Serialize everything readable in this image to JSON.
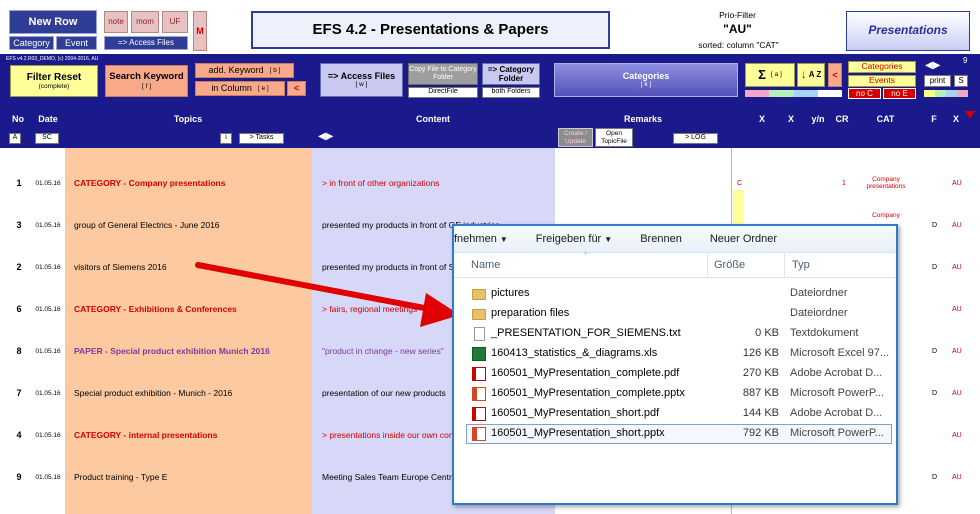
{
  "toolbar": {
    "new_row": "New Row",
    "category": "Category",
    "event": "Event",
    "note": "note",
    "mom": "mom",
    "uf": "UF",
    "access_files_small": "=> Access Files",
    "m_flag": "M",
    "title": "EFS 4.2  -  Presentations & Papers",
    "prio_filter_label": "Prio-Filter",
    "prio_filter_value": "\"AU\"",
    "sorted_label": "sorted: column \"CAT\"",
    "presentations": "Presentations",
    "version": "EFS v4.2.R03_DEMO, (c) 2004-2016, AU",
    "filter_reset": "Filter Reset",
    "filter_reset_sub": "(complete)",
    "search_keyword": "Search Keyword",
    "search_keyword_key": "[ f ]",
    "add_keyword": "add. Keyword",
    "add_keyword_key": "[ b ]",
    "in_column": "in Column",
    "in_column_key": "[ e ]",
    "lt": "<",
    "access_files": "=> Access Files",
    "access_files_key": "[ w ]",
    "copy_file": "Copy File to Category Folder",
    "direct_file": "DirectFile",
    "category_folder": "=> Category Folder",
    "both_folders": "both Folders",
    "categories": "Categories",
    "categories_key": "[ k ]",
    "sigma": "Σ",
    "sigma_key": "[ a ]",
    "sort_az": "A Z",
    "categories_btn": "Categories",
    "events_btn": "Events",
    "no_c": "no C",
    "no_e": "no E",
    "arrows": "◀▶",
    "print": "print",
    "s": "S",
    "nine": "9"
  },
  "columns": {
    "no": "No",
    "date": "Date",
    "topics": "Topics",
    "content": "Content",
    "remarks": "Remarks",
    "x1": "X",
    "x2": "X",
    "yn": "y/n",
    "cr": "CR",
    "cat": "CAT",
    "f": "F",
    "x3": "X",
    "a_btn": "A",
    "sc_btn": "SC",
    "i_btn": "i",
    "tasks_btn": "> Tasks",
    "content_arrows": "◀▶",
    "create_update": "Create / Update",
    "open_topicfile": "Open TopicFile",
    "log_btn": "> LOG"
  },
  "rows": [
    {
      "no": "1",
      "date": "01.05.16",
      "topic": "CATEGORY - Company presentations",
      "content": ">  in front of other organizations",
      "x": "C",
      "cr": "1",
      "cat": "Company presentations",
      "d": "",
      "au": "AU"
    },
    {
      "no": "3",
      "date": "01.05.16",
      "topic": "group of General Electrics - June 2016",
      "content": "presented my products in front of GE industries",
      "x": "",
      "cr": "",
      "cat": "Company",
      "d": "D",
      "au": "AU"
    },
    {
      "no": "2",
      "date": "01.05.16",
      "topic": "visitors of Siemens 2016",
      "content": "presented my products in front of Siemens",
      "x": "",
      "cr": "",
      "cat": "",
      "d": "D",
      "au": "AU"
    },
    {
      "no": "6",
      "date": "01.05.16",
      "topic": "CATEGORY - Exhibitions & Conferences",
      "content": "> fairs, regional meetings",
      "x": "",
      "cr": "",
      "cat": "",
      "d": "",
      "au": "AU"
    },
    {
      "no": "8",
      "date": "01.05.16",
      "topic": "PAPER - Special product exhibition Munich 2016",
      "content": "\"product in change - new series\"",
      "x": "",
      "cr": "",
      "cat": "",
      "d": "D",
      "au": "AU"
    },
    {
      "no": "7",
      "date": "01.05.16",
      "topic": "Special product exhibition - Munich - 2016",
      "content": "presentation of our new products",
      "x": "",
      "cr": "",
      "cat": "",
      "d": "D",
      "au": "AU"
    },
    {
      "no": "4",
      "date": "01.05.16",
      "topic": "CATEGORY - internal presentations",
      "content": "> presentations inside our own company",
      "x": "",
      "cr": "",
      "cat": "",
      "d": "",
      "au": "AU"
    },
    {
      "no": "9",
      "date": "01.05.16",
      "topic": "Product training - Type E",
      "content": "Meeting Sales Team Europe Central",
      "x": "",
      "cr": "",
      "cat": "",
      "d": "D",
      "au": "AU"
    }
  ],
  "explorer": {
    "menu": [
      "fnehmen",
      "Freigeben für",
      "Brennen",
      "Neuer Ordner"
    ],
    "headers": {
      "name": "Name",
      "size": "Größe",
      "type": "Typ"
    },
    "files": [
      {
        "name": "pictures",
        "size": "",
        "type": "Dateiordner",
        "icon": "folder"
      },
      {
        "name": "preparation files",
        "size": "",
        "type": "Dateiordner",
        "icon": "folder"
      },
      {
        "name": "_PRESENTATION_FOR_SIEMENS.txt",
        "size": "0 KB",
        "type": "Textdokument",
        "icon": "txt"
      },
      {
        "name": "160413_statistics_&_diagrams.xls",
        "size": "126 KB",
        "type": "Microsoft Excel 97...",
        "icon": "xls"
      },
      {
        "name": "160501_MyPresentation_complete.pdf",
        "size": "270 KB",
        "type": "Adobe Acrobat D...",
        "icon": "pdf"
      },
      {
        "name": "160501_MyPresentation_complete.pptx",
        "size": "887 KB",
        "type": "Microsoft PowerP...",
        "icon": "pptx"
      },
      {
        "name": "160501_MyPresentation_short.pdf",
        "size": "144 KB",
        "type": "Adobe Acrobat D...",
        "icon": "pdf"
      },
      {
        "name": "160501_MyPresentation_short.pptx",
        "size": "792 KB",
        "type": "Microsoft PowerP...",
        "icon": "pptx"
      }
    ]
  },
  "colors": {
    "navy": "#1a1a8c",
    "topics_bg": "#fdc9a0",
    "content_bg": "#d7d7f7",
    "arrow": "#e00000",
    "explorer_border": "#2c7dc9"
  }
}
